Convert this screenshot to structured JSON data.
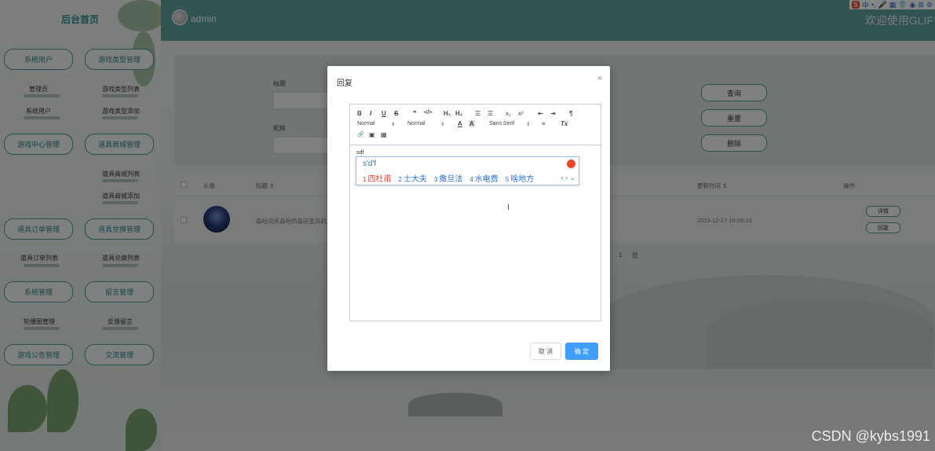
{
  "sidebar": {
    "title": "后台首页",
    "menus": [
      {
        "label": "系统用户"
      },
      {
        "label": "游戏类型管理"
      },
      {
        "label": "游戏中心管理"
      },
      {
        "label": "道具商城管理"
      },
      {
        "label": "道具订单管理"
      },
      {
        "label": "道具兑换管理"
      },
      {
        "label": "系统管理"
      },
      {
        "label": "留言管理"
      },
      {
        "label": "游戏公告管理"
      },
      {
        "label": "交流管理"
      }
    ],
    "subs": {
      "admin": "管理员",
      "sysuser": "系统用户",
      "gametype_list": "游戏类型列表",
      "gametype_add": "游戏类型添加",
      "shop_list": "道具商城列表",
      "shop_add": "道具商城添加",
      "order_list": "道具订单列表",
      "exchange_list": "道具兑换列表",
      "carousel": "轮播图管理",
      "feedback": "反馈留言"
    }
  },
  "header": {
    "username": "admin",
    "welcome": "欢迎使用GLIF"
  },
  "ime_status": [
    "中",
    "•,",
    "🎤",
    "▦",
    "👕",
    "◉",
    "⊞",
    "⚙"
  ],
  "search": {
    "title_label": "标题",
    "nickname_label": "昵称",
    "query_button": "查询",
    "reset_button": "重置",
    "delete_button": "删除"
  },
  "table": {
    "headers": {
      "avatar": "头像",
      "title": "标题 ⇕",
      "time": "更新时间 ⇕",
      "op": "操作"
    },
    "row": {
      "title": "森哈讯采森哈的森讯变风机",
      "time": "2023-12-27 16:08:23",
      "detail_button": "详情",
      "reply_button": "回复"
    },
    "pager": {
      "page": "1",
      "unit": "页"
    }
  },
  "dialog": {
    "title": "回复",
    "close": "×",
    "toolbar": {
      "bold": "B",
      "italic": "I",
      "underline": "U",
      "strike": "S",
      "quote": "❞",
      "code": "</>",
      "h1": "H₁",
      "h2": "H₂",
      "ol": "☰",
      "ul": "☰",
      "sub": "x₁",
      "sup": "x²",
      "indent_dec": "⇤",
      "indent_inc": "⇥",
      "rtl": "¶",
      "size": "Normal",
      "header": "Normal",
      "font": "Sans Serif",
      "color": "A",
      "bg": "A",
      "align": "≡",
      "clean": "Tx",
      "link": "🔗",
      "image": "▣",
      "video": "▦"
    },
    "content": "sdf",
    "ime": {
      "input": "s'd'f",
      "candidates": [
        {
          "n": "1",
          "text": "四杜甫"
        },
        {
          "n": "2",
          "text": "士大夫"
        },
        {
          "n": "3",
          "text": "撒旦法"
        },
        {
          "n": "4",
          "text": "水电费"
        },
        {
          "n": "5",
          "text": "啥地方"
        }
      ],
      "nav": "‹ › ⌄"
    },
    "cancel_button": "取 消",
    "ok_button": "确 定"
  },
  "watermark": "CSDN @kybs1991",
  "colors": {
    "accent": "#409eff",
    "teal": "#5e9f9c",
    "ime_red": "#e8452c",
    "ime_blue": "#2b6fd6"
  }
}
